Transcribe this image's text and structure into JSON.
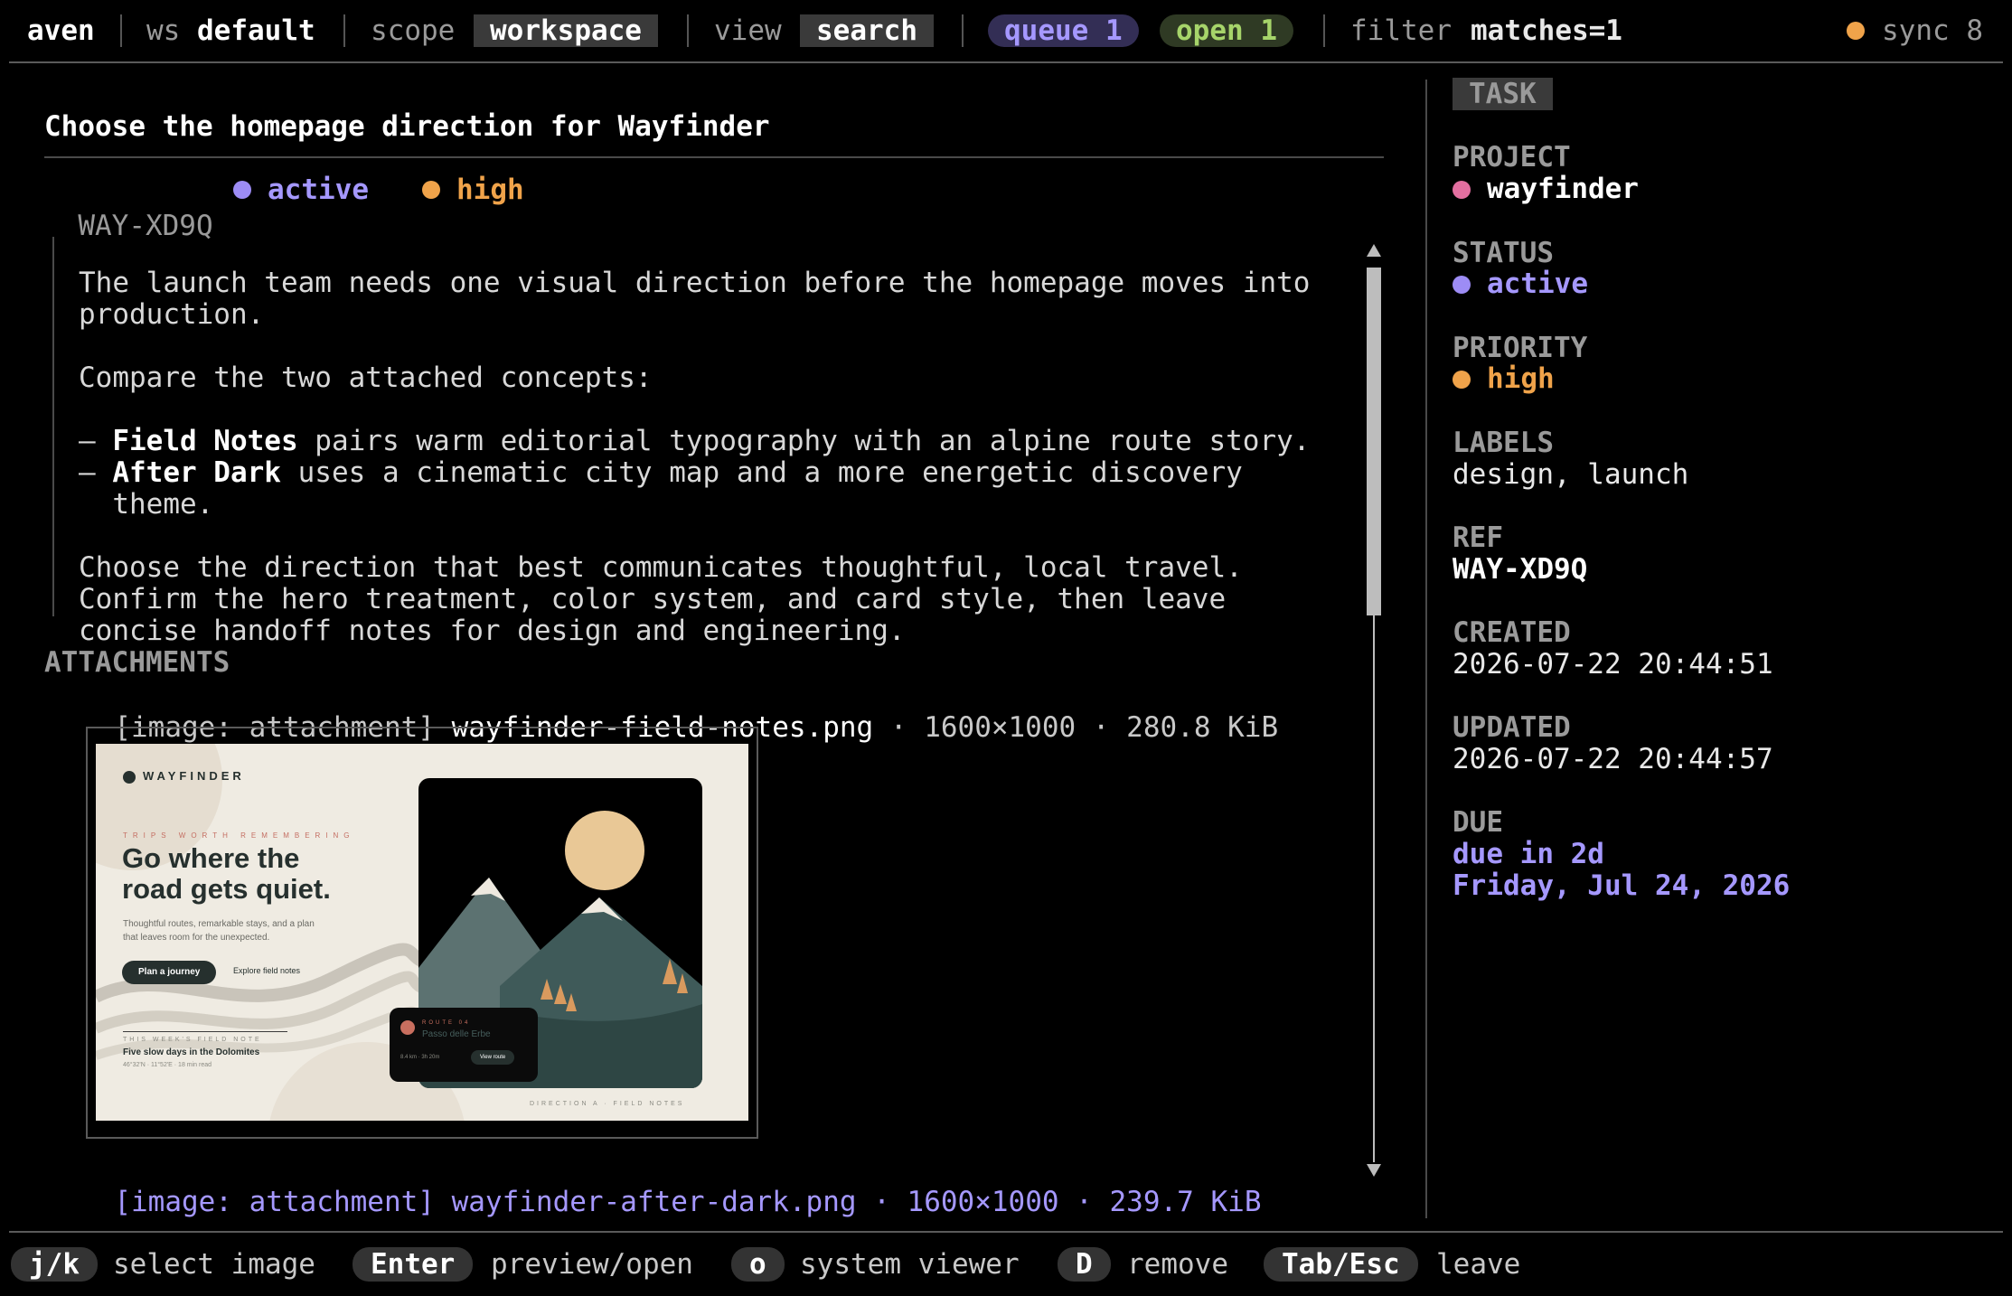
{
  "topbar": {
    "app": "aven",
    "ws_label": "ws",
    "ws_value": "default",
    "scope_label": "scope",
    "scope_value": "workspace",
    "view_label": "view",
    "view_value": "search",
    "queue": "queue 1",
    "open": "open 1",
    "filter_label": "filter",
    "filter_value": "matches=1",
    "sync": "sync 8"
  },
  "task": {
    "title": "Choose the homepage direction for Wayfinder",
    "ref": "WAY-XD9Q",
    "status": "active",
    "priority": "high",
    "body": {
      "p1a": "The launch team needs one visual direction before the homepage moves into",
      "p1b": "production.",
      "p2": "Compare the two attached concepts:",
      "li1_bold": "Field Notes",
      "li1_rest": " pairs warm editorial typography with an alpine route story.",
      "li2_bold": "After Dark",
      "li2_rest": " uses a cinematic city map and a more energetic discovery",
      "li2_cont": "theme.",
      "p3a": "Choose the direction that best communicates thoughtful, local travel.",
      "p3b": "Confirm the hero treatment, color system, and card style, then leave",
      "p3c": "concise handoff notes for design and engineering."
    },
    "attachments_heading": "ATTACHMENTS",
    "attachments": [
      {
        "tag": "[image: attachment]",
        "name": "wayfinder-field-notes.png",
        "meta": "· 1600×1000 · 280.8 KiB"
      },
      {
        "tag": "[image: attachment]",
        "name": "wayfinder-after-dark.png",
        "meta": "· 1600×1000 · 239.7 KiB"
      }
    ]
  },
  "preview": {
    "brand": "WAYFINDER",
    "kicker": "TRIPS WORTH REMEMBERING",
    "headline1": "Go where the",
    "headline2": "road gets quiet.",
    "sub1": "Thoughtful routes, remarkable stays, and a plan",
    "sub2": "that leaves room for the unexpected.",
    "cta": "Plan a journey",
    "link": "Explore field notes",
    "week": "THIS WEEK'S FIELD NOTE",
    "story": "Five slow days in the Dolomites",
    "coords": "46°32'N · 11°52'E · 18 min read",
    "route_kicker": "ROUTE 04",
    "route_name": "Passo delle Erbe",
    "route_meta": "8.4 km · 3h 20m",
    "route_btn": "View route",
    "footer": "DIRECTION A · FIELD NOTES"
  },
  "sidebar": {
    "heading": "TASK",
    "project_label": "PROJECT",
    "project": "wayfinder",
    "status_label": "STATUS",
    "status": "active",
    "priority_label": "PRIORITY",
    "priority": "high",
    "labels_label": "LABELS",
    "labels": "design, launch",
    "ref_label": "REF",
    "ref": "WAY-XD9Q",
    "created_label": "CREATED",
    "created": "2026-07-22 20:44:51",
    "updated_label": "UPDATED",
    "updated": "2026-07-22 20:44:57",
    "due_label": "DUE",
    "due_rel": "due in 2d",
    "due_date": "Friday, Jul 24, 2026"
  },
  "footer": {
    "k1": "j/k",
    "l1": "select image",
    "k2": "Enter",
    "l2": "preview/open",
    "k3": "o",
    "l3": "system viewer",
    "k4": "D",
    "l4": "remove",
    "k5": "Tab/Esc",
    "l5": "leave"
  },
  "colors": {
    "purple": "#9d8cf5",
    "orange": "#f0a34a",
    "green": "#9ccc6a",
    "pink": "#e36fa0",
    "queue_bg": "#332e55",
    "open_bg": "#2f3a24"
  }
}
